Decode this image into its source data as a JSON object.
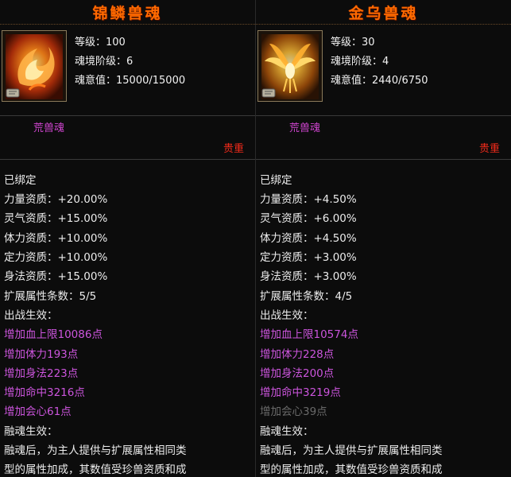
{
  "left": {
    "title": "锦鳞兽魂",
    "level_label": "等级：",
    "level_value": "100",
    "realm_label": "魂境阶级：",
    "realm_value": "6",
    "soul_label": "魂意值：",
    "soul_value": "15000/15000",
    "type": "荒兽魂",
    "quality": "贵重",
    "bound": "已绑定",
    "aptitudes": [
      {
        "label": "力量资质：",
        "value": "+20.00%"
      },
      {
        "label": "灵气资质：",
        "value": "+15.00%"
      },
      {
        "label": "体力资质：",
        "value": "+10.00%"
      },
      {
        "label": "定力资质：",
        "value": "+10.00%"
      },
      {
        "label": "身法资质：",
        "value": "+15.00%"
      }
    ],
    "ext_label": "扩展属性条数：",
    "ext_value": "5/5",
    "battle_title": "出战生效：",
    "battle_effects": [
      {
        "text": "增加血上限10086点",
        "active": true
      },
      {
        "text": "增加体力193点",
        "active": true
      },
      {
        "text": "增加身法223点",
        "active": true
      },
      {
        "text": "增加命中3216点",
        "active": true
      },
      {
        "text": "增加会心61点",
        "active": true
      }
    ],
    "fusion_title": "融魂生效：",
    "fusion_line1": "融魂后，为主人提供与扩展属性相同类",
    "fusion_line2": "型的属性加成，其数值受珍兽资质和成"
  },
  "right": {
    "title": "金乌兽魂",
    "level_label": "等级：",
    "level_value": "30",
    "realm_label": "魂境阶级：",
    "realm_value": "4",
    "soul_label": "魂意值：",
    "soul_value": "2440/6750",
    "type": "荒兽魂",
    "quality": "贵重",
    "bound": "已绑定",
    "aptitudes": [
      {
        "label": "力量资质：",
        "value": "+4.50%"
      },
      {
        "label": "灵气资质：",
        "value": "+6.00%"
      },
      {
        "label": "体力资质：",
        "value": "+4.50%"
      },
      {
        "label": "定力资质：",
        "value": "+3.00%"
      },
      {
        "label": "身法资质：",
        "value": "+3.00%"
      }
    ],
    "ext_label": "扩展属性条数：",
    "ext_value": "4/5",
    "battle_title": "出战生效：",
    "battle_effects": [
      {
        "text": "增加血上限10574点",
        "active": true
      },
      {
        "text": "增加体力228点",
        "active": true
      },
      {
        "text": "增加身法200点",
        "active": true
      },
      {
        "text": "增加命中3219点",
        "active": true
      },
      {
        "text": "增加会心39点",
        "active": false
      }
    ],
    "fusion_title": "融魂生效：",
    "fusion_line1": "融魂后，为主人提供与扩展属性相同类",
    "fusion_line2": "型的属性加成，其数值受珍兽资质和成"
  },
  "colors": {
    "title": "#ff6a00",
    "type": "#cc44cc",
    "quality": "#ee2a1a",
    "effect_active": "#cc55dd",
    "effect_inactive": "#6a6a6a"
  },
  "icons": {
    "left": "fire-fish-soul-icon",
    "right": "golden-crow-soul-icon",
    "badge": "scroll-badge-icon"
  }
}
